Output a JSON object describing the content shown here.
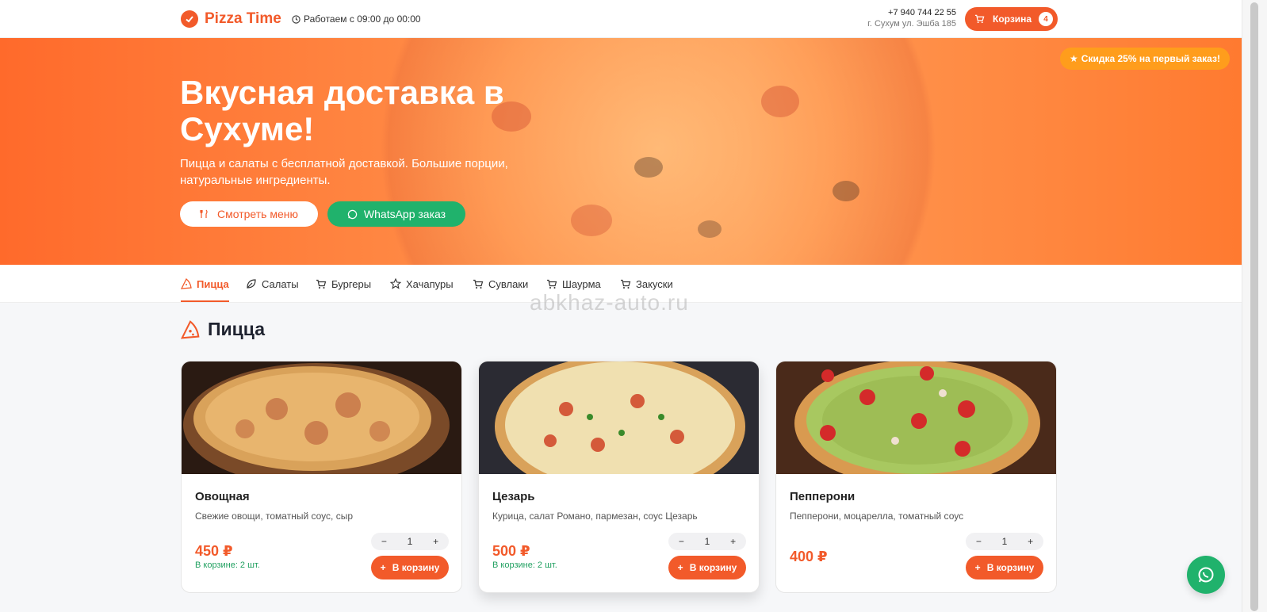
{
  "header": {
    "brand": "Pizza Time",
    "hours": "Работаем с 09:00 до 00:00",
    "phone": "+7 940 744 22 55",
    "address": "г. Сухум ул. Эшба 185",
    "cart_label": "Корзина",
    "cart_count": "4"
  },
  "hero": {
    "title": "Вкусная доставка в Сухуме!",
    "subtitle": "Пицца и салаты с бесплатной доставкой. Большие порции, натуральные ингредиенты.",
    "menu_button": "Смотреть меню",
    "whatsapp_button": "WhatsApp заказ",
    "discount_badge": "Скидка 25% на первый заказ!"
  },
  "categories": [
    {
      "label": "Пицца",
      "icon": "pizza-slice-icon"
    },
    {
      "label": "Салаты",
      "icon": "leaf-icon"
    },
    {
      "label": "Бургеры",
      "icon": "cart-icon"
    },
    {
      "label": "Хачапуры",
      "icon": "star-icon"
    },
    {
      "label": "Сувлаки",
      "icon": "cart-icon"
    },
    {
      "label": "Шаурма",
      "icon": "cart-icon"
    },
    {
      "label": "Закуски",
      "icon": "cart-icon"
    }
  ],
  "watermark": "abkhaz-auto.ru",
  "section": {
    "title": "Пицца"
  },
  "products": [
    {
      "name": "Овощная",
      "desc": "Свежие овощи, томатный соус, сыр",
      "price": "450 ₽",
      "qty": "1",
      "in_cart": "В корзине: 2 шт.",
      "add_label": "В корзину"
    },
    {
      "name": "Цезарь",
      "desc": "Курица, салат Романо, пармезан, соус Цезарь",
      "price": "500 ₽",
      "qty": "1",
      "in_cart": "В корзине: 2 шт.",
      "add_label": "В корзину"
    },
    {
      "name": "Пепперони",
      "desc": "Пепперони, моцарелла, томатный соус",
      "price": "400 ₽",
      "qty": "1",
      "in_cart": "",
      "add_label": "В корзину"
    }
  ],
  "stepper": {
    "minus": "−",
    "plus": "+"
  },
  "colors": {
    "accent": "#f25a2a",
    "whatsapp": "#20b26c",
    "discount": "#ff9d1c"
  }
}
